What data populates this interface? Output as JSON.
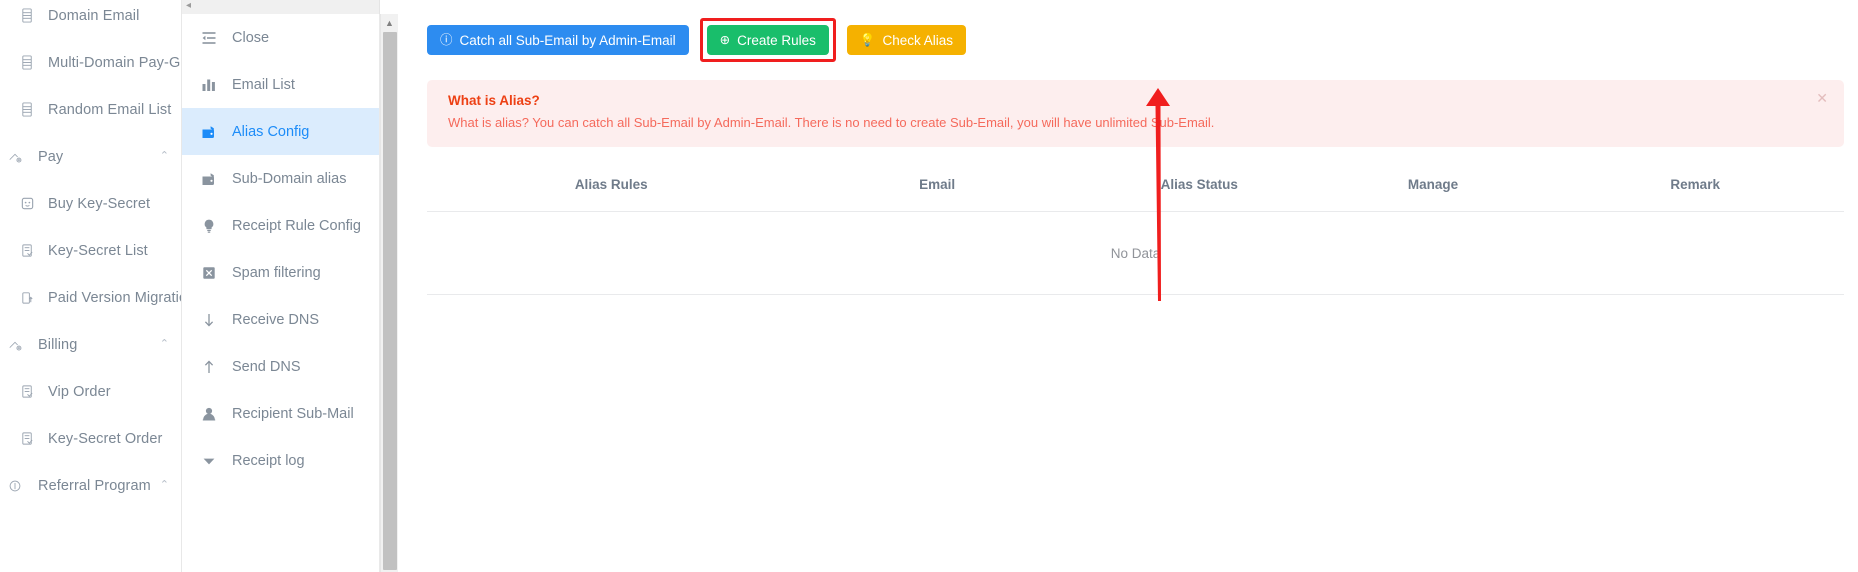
{
  "sidebar": {
    "items": [
      {
        "label": "Domain Email",
        "icon": "domain-email-icon",
        "type": "child",
        "caret": ""
      },
      {
        "label": "Multi-Domain Pay-Group",
        "icon": "domain-email-icon",
        "type": "child",
        "caret": ""
      },
      {
        "label": "Random Email List",
        "icon": "domain-email-icon",
        "type": "child",
        "caret": ""
      },
      {
        "label": "Pay",
        "icon": "pay-icon",
        "type": "group",
        "caret": "⌃"
      },
      {
        "label": "Buy Key-Secret",
        "icon": "buy-key-secret-icon",
        "type": "child",
        "caret": ""
      },
      {
        "label": "Key-Secret List",
        "icon": "list-doc-icon",
        "type": "child",
        "caret": ""
      },
      {
        "label": "Paid Version Migration",
        "icon": "upgrade-icon",
        "type": "child",
        "caret": ""
      },
      {
        "label": "Billing",
        "icon": "billing-icon",
        "type": "group",
        "caret": "⌃"
      },
      {
        "label": "Vip Order",
        "icon": "list-doc-icon",
        "type": "child",
        "caret": ""
      },
      {
        "label": "Key-Secret Order",
        "icon": "list-doc-icon",
        "type": "child",
        "caret": ""
      },
      {
        "label": "Referral Program",
        "icon": "referral-icon",
        "type": "group",
        "caret": "⌃"
      }
    ]
  },
  "subnav": {
    "collapse_caret": "◂",
    "items": [
      {
        "label": "Close",
        "icon": "collapse-menu-icon",
        "active": false
      },
      {
        "label": "Email List",
        "icon": "bar-chart-icon",
        "active": false
      },
      {
        "label": "Alias Config",
        "icon": "wallet-icon",
        "active": true
      },
      {
        "label": "Sub-Domain alias",
        "icon": "wallet-icon",
        "active": false
      },
      {
        "label": "Receipt Rule Config",
        "icon": "bulb-icon",
        "active": false
      },
      {
        "label": "Spam filtering",
        "icon": "spam-icon",
        "active": false
      },
      {
        "label": "Receive DNS",
        "icon": "arrow-down-icon",
        "active": false
      },
      {
        "label": "Send DNS",
        "icon": "arrow-up-icon",
        "active": false
      },
      {
        "label": "Recipient Sub-Mail",
        "icon": "user-icon",
        "active": false
      },
      {
        "label": "Receipt log",
        "icon": "triangle-down-icon",
        "active": false
      }
    ]
  },
  "toolbar": {
    "catch_all_label": "Catch all Sub-Email by Admin-Email",
    "catch_all_icon": "info-circle-icon",
    "create_rules_label": "Create Rules",
    "create_rules_icon": "plus-circle-icon",
    "check_alias_label": "Check Alias",
    "check_alias_icon": "bulb-icon",
    "highlighted_button": "Create Rules",
    "colors": {
      "blue": "#2d8cf0",
      "green": "#19be6b",
      "orange": "#f5b100",
      "highlight": "#f01e1e"
    }
  },
  "alert": {
    "title": "What is Alias?",
    "description": "What is alias? You can catch all Sub-Email by Admin-Email. There is no need to create Sub-Email, you will have unlimited Sub-Email.",
    "close_icon": "✕",
    "background": "#fdeeee",
    "title_color": "#ed4014"
  },
  "table": {
    "columns": [
      "Alias Rules",
      "Email",
      "Alias Status",
      "Manage",
      "Remark"
    ],
    "rows": [],
    "empty_text": "No Data"
  },
  "annotation": {
    "arrow_color": "#f01e1e",
    "points_to": "Create Rules"
  }
}
